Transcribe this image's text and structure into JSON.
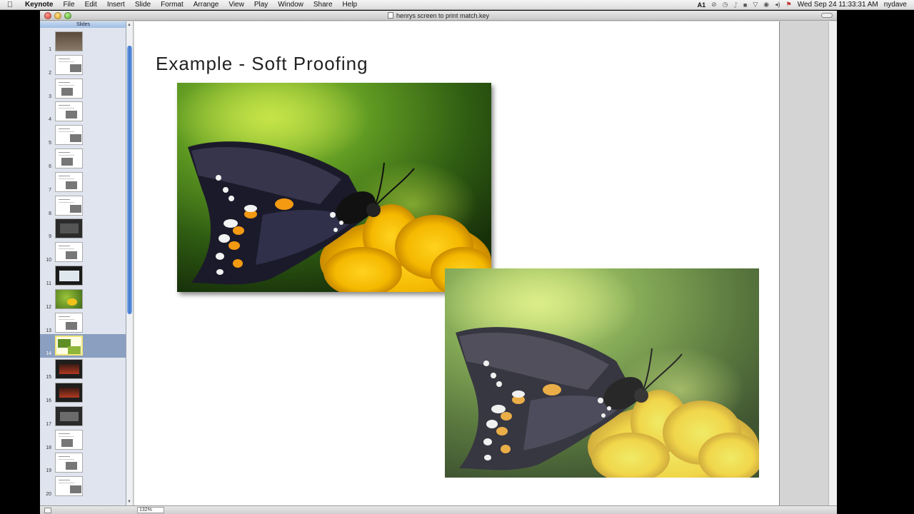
{
  "menubar": {
    "apple": "",
    "menus": [
      "Keynote",
      "File",
      "Edit",
      "Insert",
      "Slide",
      "Format",
      "Arrange",
      "View",
      "Play",
      "Window",
      "Share",
      "Help"
    ],
    "status_badge": "1",
    "datetime": "Wed Sep 24  11:33:31 AM",
    "user": "nydave",
    "status_icons": [
      "adobe-icon",
      "block-icon",
      "time-machine-icon",
      "bluetooth-icon",
      "lock-icon",
      "wifi-icon",
      "battery-icon",
      "volume-icon",
      "flag-icon"
    ]
  },
  "window": {
    "title": "henrys screen to print match.key"
  },
  "navigator": {
    "header": "Slides",
    "selected": 14,
    "slides": [
      {
        "num": "1"
      },
      {
        "num": "2"
      },
      {
        "num": "3"
      },
      {
        "num": "4"
      },
      {
        "num": "5"
      },
      {
        "num": "6"
      },
      {
        "num": "7"
      },
      {
        "num": "8"
      },
      {
        "num": "9"
      },
      {
        "num": "10"
      },
      {
        "num": "11"
      },
      {
        "num": "12"
      },
      {
        "num": "13"
      },
      {
        "num": "14"
      },
      {
        "num": "15"
      },
      {
        "num": "16"
      },
      {
        "num": "17"
      },
      {
        "num": "18"
      },
      {
        "num": "19"
      },
      {
        "num": "20"
      }
    ]
  },
  "slide": {
    "title": "Example - Soft Proofing"
  },
  "statusbar": {
    "zoom": "132%"
  },
  "colors": {
    "selection": "#8b9fc1",
    "scroll_accent": "#3c74cf"
  }
}
